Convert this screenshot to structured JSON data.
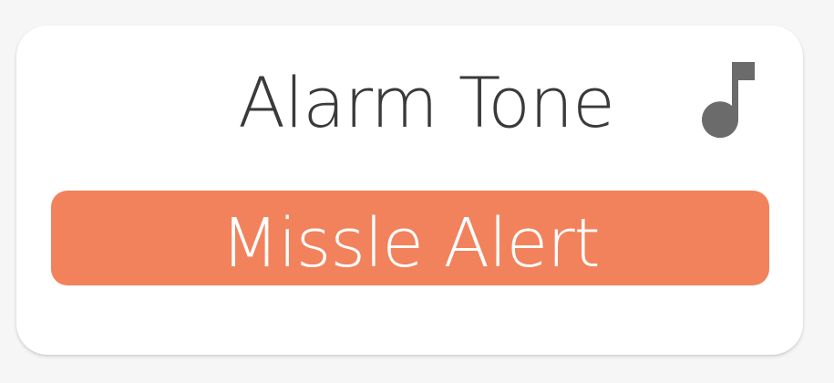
{
  "card": {
    "title": "Alarm Tone",
    "icon": "music-note-icon",
    "selected_tone": "Missle Alert"
  },
  "colors": {
    "background": "#f6f6f6",
    "card": "#ffffff",
    "title_text": "#3a3a3a",
    "icon": "#6b6b6b",
    "button": "#f2825c",
    "button_text": "#ffffff"
  }
}
